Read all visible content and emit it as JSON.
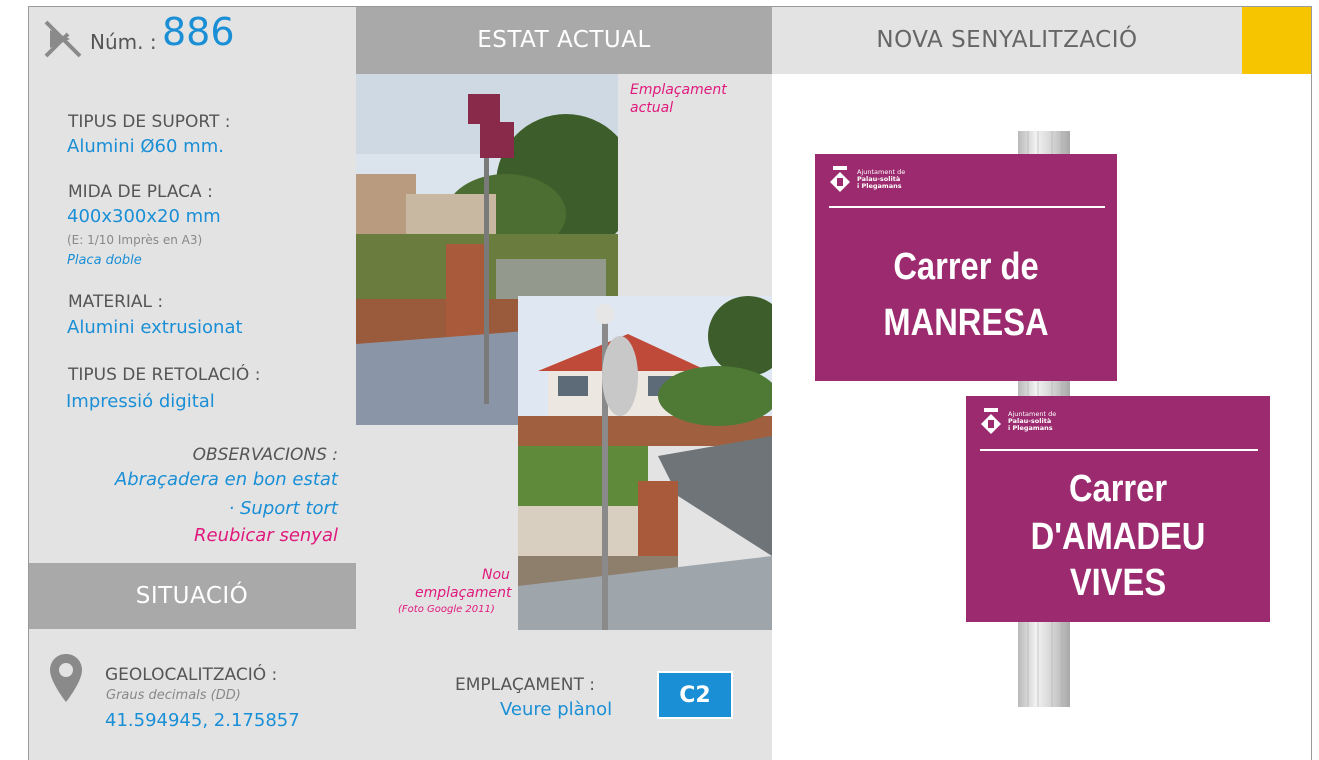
{
  "header": {
    "num_label": "Núm. :",
    "num_value": "886",
    "estat_actual": "ESTAT ACTUAL",
    "nova_senyalitzacio": "NOVA SENYALITZACIÓ"
  },
  "specs": {
    "tipus_suport_label": "TIPUS DE SUPORT :",
    "tipus_suport_value": "Alumini Ø60 mm.",
    "mida_placa_label": "MIDA DE PLACA :",
    "mida_placa_value": "400x300x20 mm",
    "mida_placa_note": "(E: 1/10 Imprès en A3)",
    "mida_placa_type": "Placa doble",
    "material_label": "MATERIAL :",
    "material_value": "Alumini extrusionat",
    "retolacio_label": "TIPUS DE RETOLACIÓ :",
    "retolacio_value": "Impressió digital"
  },
  "observacions": {
    "label": "OBSERVACIONS :",
    "line1": "Abraçadera en bon estat",
    "line2": "· Suport tort",
    "line3": "Reubicar senyal"
  },
  "situacio": {
    "title": "SITUACIÓ",
    "geo_label": "GEOLOCALITZACIÓ :",
    "geo_format": "Graus decimals (DD)",
    "geo_coords": "41.594945, 2.175857"
  },
  "photos": {
    "actual_caption_1": "Emplaçament",
    "actual_caption_2": "actual",
    "nou_caption_1": "Nou",
    "nou_caption_2": "emplaçament",
    "nou_caption_3": "(Foto Google 2011)"
  },
  "emplacament": {
    "label": "EMPLAÇAMENT :",
    "value": "Veure plànol",
    "code": "C2"
  },
  "signs": {
    "logo_line1": "Ajuntament de",
    "logo_line2": "Palau-solità",
    "logo_line3": "i Plegamans",
    "sign1_line1": "Carrer de",
    "sign1_line2": "MANRESA",
    "sign2_line1": "Carrer",
    "sign2_line2": "D'AMADEU",
    "sign2_line3": "VIVES"
  },
  "colors": {
    "accent_blue": "#1a8fd6",
    "accent_pink": "#e0197d",
    "sign_purple": "#9b2a6e",
    "header_yellow": "#f7c500"
  }
}
